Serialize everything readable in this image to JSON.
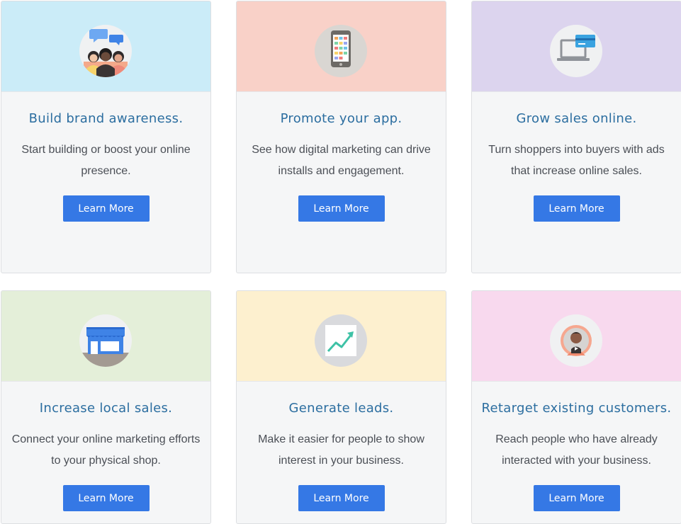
{
  "cards": [
    {
      "title": "Build brand awareness.",
      "description": "Start building or boost your online presence.",
      "button": "Learn More",
      "top_color": "#cbecf8",
      "icon": "people-chat-icon"
    },
    {
      "title": "Promote your app.",
      "description": "See how digital marketing can drive installs and engagement.",
      "button": "Learn More",
      "top_color": "#f9d1c8",
      "icon": "smartphone-icon"
    },
    {
      "title": "Grow sales online.",
      "description": "Turn shoppers into buyers with ads that increase online sales.",
      "button": "Learn More",
      "top_color": "#dcd4ee",
      "icon": "laptop-credit-card-icon"
    },
    {
      "title": "Increase local sales.",
      "description": "Connect your online marketing efforts to your physical shop.",
      "button": "Learn More",
      "top_color": "#e4efd9",
      "icon": "storefront-icon"
    },
    {
      "title": "Generate leads.",
      "description": "Make it easier for people to show interest in your business.",
      "button": "Learn More",
      "top_color": "#fdf0cf",
      "icon": "trending-chart-icon"
    },
    {
      "title": "Retarget existing customers.",
      "description": "Reach people who have already interacted with your business.",
      "button": "Learn More",
      "top_color": "#f8d9ee",
      "icon": "customer-avatar-icon"
    }
  ]
}
